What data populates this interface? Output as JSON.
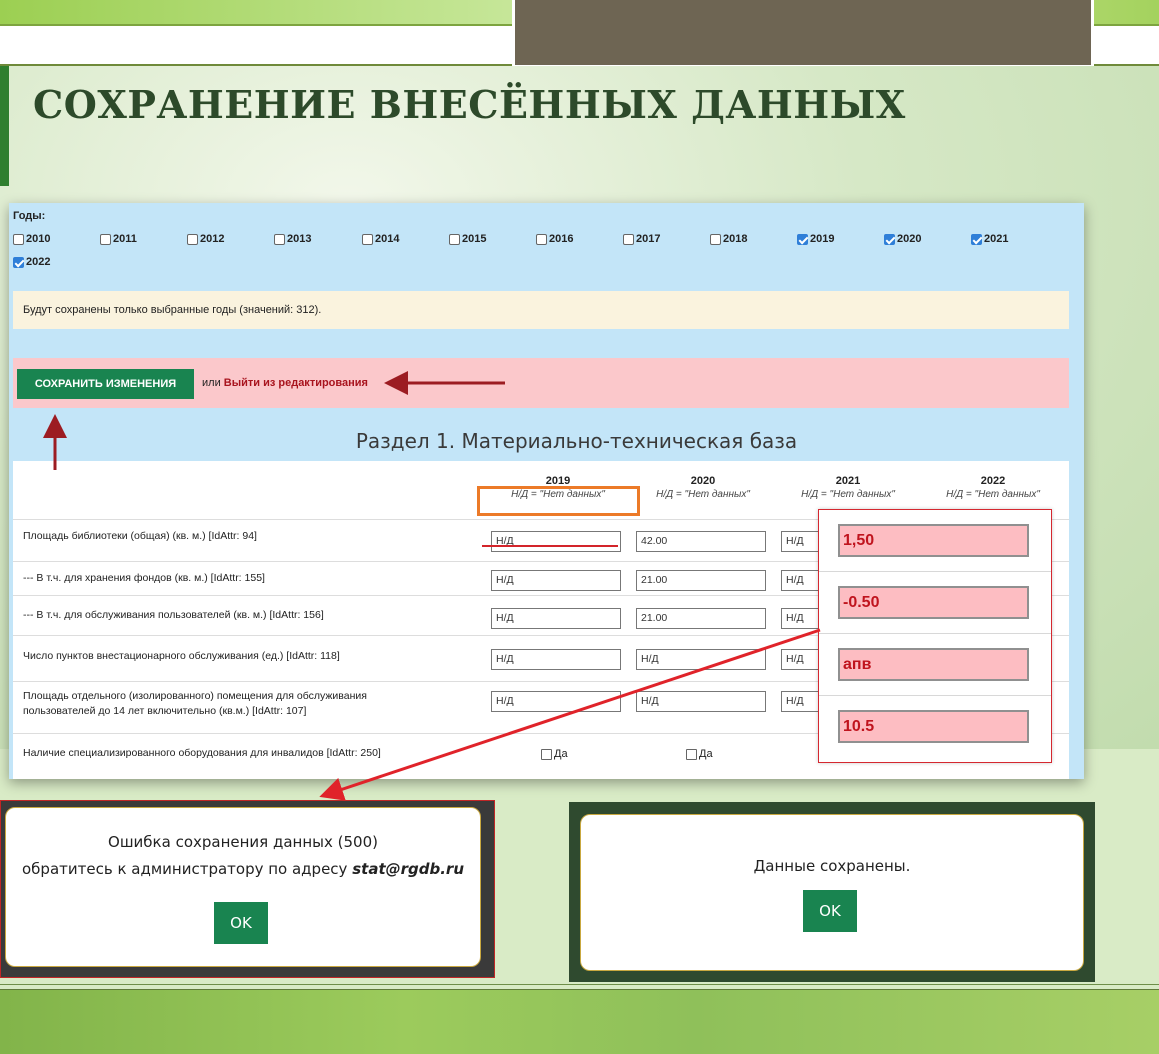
{
  "slide": {
    "title": "СОХРАНЕНИЕ ВНЕСЁННЫХ ДАННЫХ"
  },
  "years": {
    "label": "Годы:",
    "items": [
      {
        "label": "2010",
        "checked": false
      },
      {
        "label": "2011",
        "checked": false
      },
      {
        "label": "2012",
        "checked": false
      },
      {
        "label": "2013",
        "checked": false
      },
      {
        "label": "2014",
        "checked": false
      },
      {
        "label": "2015",
        "checked": false
      },
      {
        "label": "2016",
        "checked": false
      },
      {
        "label": "2017",
        "checked": false
      },
      {
        "label": "2018",
        "checked": false
      },
      {
        "label": "2019",
        "checked": true
      },
      {
        "label": "2020",
        "checked": true
      },
      {
        "label": "2021",
        "checked": true
      },
      {
        "label": "2022",
        "checked": true
      }
    ]
  },
  "notice": "Будут сохранены только выбранные годы (значений: 312).",
  "actions": {
    "save_label": "СОХРАНИТЬ ИЗМЕНЕНИЯ",
    "or_text": "или",
    "exit_label": "Выйти из редактирования"
  },
  "section_title": "Раздел 1. Материально-техническая база",
  "table": {
    "columns": [
      {
        "year": "2019",
        "note": "Н/Д = \"Нет данных\""
      },
      {
        "year": "2020",
        "note": "Н/Д = \"Нет данных\""
      },
      {
        "year": "2021",
        "note": "Н/Д = \"Нет данных\""
      },
      {
        "year": "2022",
        "note": "Н/Д = \"Нет данных\""
      }
    ],
    "rows": [
      {
        "label": "Площадь библиотеки (общая) (кв. м.) [IdAttr: 94]",
        "v2019": "Н/Д",
        "v2020": "42.00",
        "v2021": "Н/Д"
      },
      {
        "label": "--- В т.ч. для хранения фондов (кв. м.) [IdAttr: 155]",
        "v2019": "Н/Д",
        "v2020": "21.00",
        "v2021": "Н/Д"
      },
      {
        "label": "--- В т.ч. для обслуживания пользователей (кв. м.) [IdAttr: 156]",
        "v2019": "Н/Д",
        "v2020": "21.00",
        "v2021": "Н/Д"
      },
      {
        "label": "Число пунктов внестационарного обслуживания (ед.) [IdAttr: 118]",
        "v2019": "Н/Д",
        "v2020": "Н/Д",
        "v2021": "Н/Д"
      },
      {
        "label_line1": "Площадь отдельного (изолированного) помещения для обслуживания",
        "label_line2": "пользователей до 14 лет включительно (кв.м.) [IdAttr: 107]",
        "v2019": "Н/Д",
        "v2020": "Н/Д",
        "v2021": "Н/Д"
      },
      {
        "label": "Наличие специализированного оборудования для инвалидов [IdAttr: 250]",
        "yes_label": "Да"
      }
    ]
  },
  "invalid_inputs": [
    "1,50",
    "-0.50",
    "апв",
    "10.5"
  ],
  "error_dialog": {
    "line1": "Ошибка сохранения данных (500)",
    "line2": "обратитесь к администратору по адресу",
    "email": "stat@rgdb.ru",
    "ok": "OK"
  },
  "success_dialog": {
    "message": "Данные сохранены.",
    "ok": "OK"
  },
  "colors": {
    "save_green": "#198450",
    "error_red": "#d3242a",
    "highlight_orange": "#ec7a28",
    "invalid_pink": "#fdbdc2"
  }
}
